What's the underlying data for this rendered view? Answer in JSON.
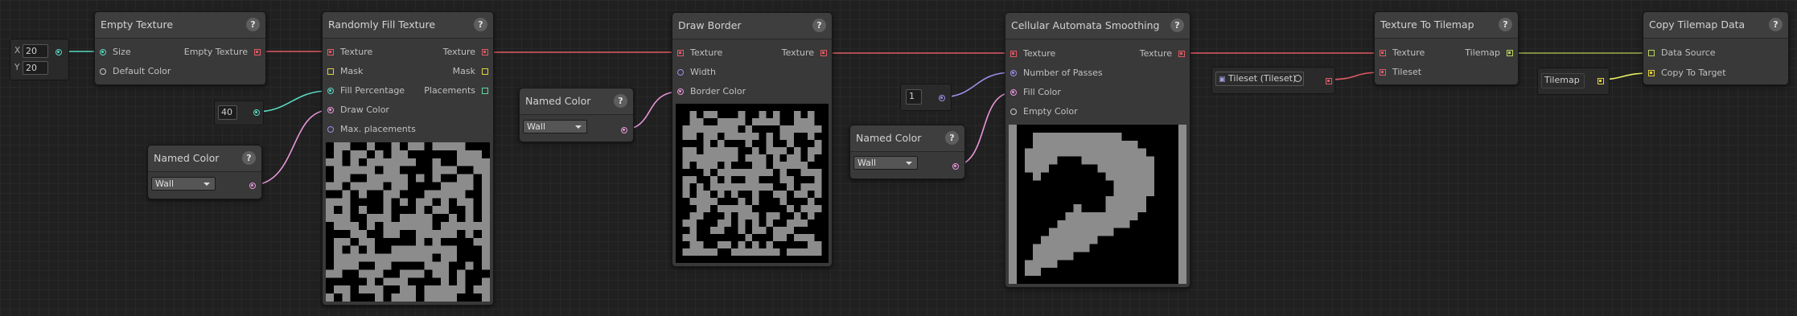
{
  "nodes": {
    "empty_texture": {
      "title": "Empty Texture",
      "in_size": "Size",
      "in_default_color": "Default Color",
      "out_texture": "Empty Texture"
    },
    "size_field": {
      "x_label": "X",
      "x_value": "20",
      "y_label": "Y",
      "y_value": "20"
    },
    "randomly_fill": {
      "title": "Randomly Fill Texture",
      "in_texture": "Texture",
      "in_mask": "Mask",
      "in_fill_percentage": "Fill Percentage",
      "in_draw_color": "Draw Color",
      "in_max_placements": "Max. placements",
      "out_texture": "Texture",
      "out_mask": "Mask",
      "out_placements": "Placements"
    },
    "fill_percentage_field": {
      "value": "40"
    },
    "named_color_1": {
      "title": "Named Color",
      "value": "Wall"
    },
    "named_color_2": {
      "title": "Named Color",
      "value": "Wall"
    },
    "named_color_3": {
      "title": "Named Color",
      "value": "Wall"
    },
    "draw_border": {
      "title": "Draw Border",
      "in_texture": "Texture",
      "in_width": "Width",
      "in_border_color": "Border Color",
      "out_texture": "Texture"
    },
    "passes_field": {
      "value": "1"
    },
    "cellular": {
      "title": "Cellular Automata Smoothing",
      "in_texture": "Texture",
      "in_passes": "Number of Passes",
      "in_fill_color": "Fill Color",
      "in_empty_color": "Empty Color",
      "out_texture": "Texture"
    },
    "tileset_field": {
      "value": "Tileset (Tileset)"
    },
    "texture_to_tilemap": {
      "title": "Texture To Tilemap",
      "in_texture": "Texture",
      "in_tileset": "Tileset",
      "out_tilemap": "Tilemap"
    },
    "tilemap_field": {
      "value": "Tilemap"
    },
    "copy_tilemap": {
      "title": "Copy Tilemap Data",
      "in_data_source": "Data Source",
      "in_copy_to_target": "Copy To Target"
    }
  },
  "help_glyph": "?",
  "colors": {
    "texture_wire": "#e05a64",
    "size_wire": "#58d8c0",
    "color_wire": "#e896d8",
    "int_wire": "#9a90e8",
    "tilemap_wire": "#b8d060",
    "target_wire": "#e8f060"
  }
}
